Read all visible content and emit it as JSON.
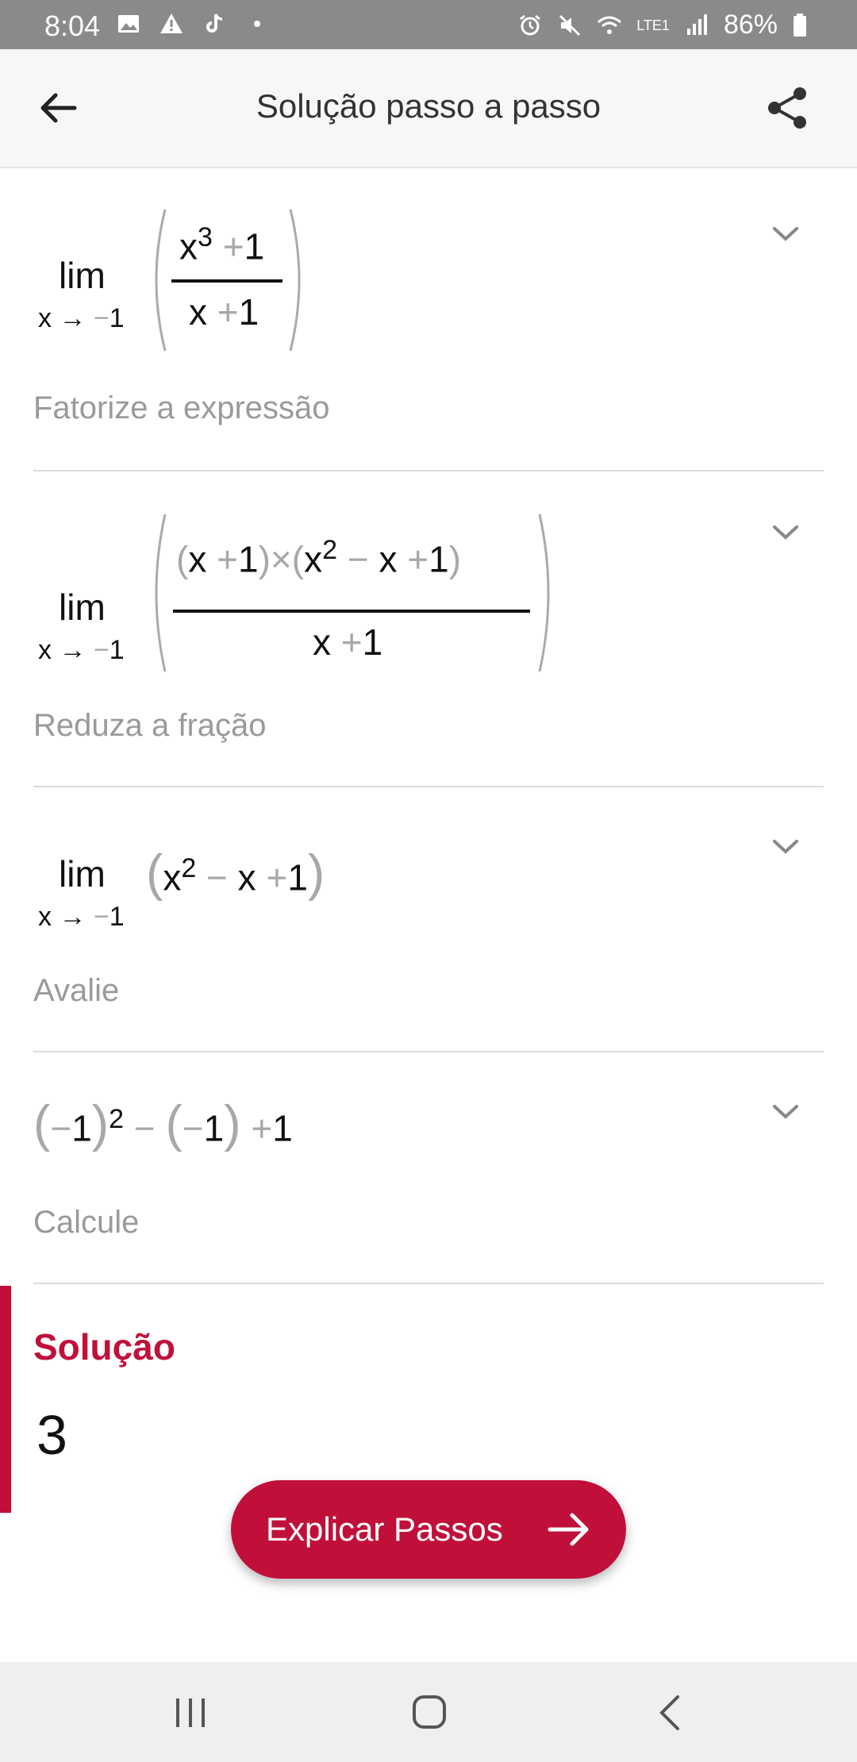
{
  "status_bar": {
    "time": "8:04",
    "battery": "86%",
    "network": "LTE1"
  },
  "app_bar": {
    "title": "Solução passo a passo"
  },
  "steps": [
    {
      "lim_word": "lim",
      "lim_var": "x",
      "lim_arrow": "→",
      "lim_minus": "−",
      "lim_target": "1",
      "num_x": "x",
      "num_exp": "3",
      "num_plus": "+",
      "num_one": "1",
      "den_x": "x",
      "den_plus": "+",
      "den_one": "1",
      "description": "Fatorize a expressão"
    },
    {
      "lim_word": "lim",
      "lim_var": "x",
      "lim_arrow": "→",
      "lim_minus": "−",
      "lim_target": "1",
      "f1_x": "x",
      "f1_plus": "+",
      "f1_one": "1",
      "times": "×",
      "f2_x": "x",
      "f2_exp": "2",
      "f2_minus": "−",
      "f2_x2": "x",
      "f2_plus": "+",
      "f2_one": "1",
      "den_x": "x",
      "den_plus": "+",
      "den_one": "1",
      "description": "Reduza a fração"
    },
    {
      "lim_word": "lim",
      "lim_var": "x",
      "lim_arrow": "→",
      "lim_minus": "−",
      "lim_target": "1",
      "x": "x",
      "exp": "2",
      "minus": "−",
      "x2": "x",
      "plus": "+",
      "one": "1",
      "description": "Avalie"
    },
    {
      "a_minus": "−",
      "a_one": "1",
      "exp": "2",
      "minus": "−",
      "b_minus": "−",
      "b_one": "1",
      "plus": "+",
      "one": "1",
      "description": "Calcule"
    }
  ],
  "solution": {
    "title": "Solução",
    "value": "3"
  },
  "explain_button": {
    "label": "Explicar Passos"
  },
  "colors": {
    "accent": "#c0103a",
    "muted_text": "#9a9a9a",
    "status_bar": "#8a8a8a"
  }
}
